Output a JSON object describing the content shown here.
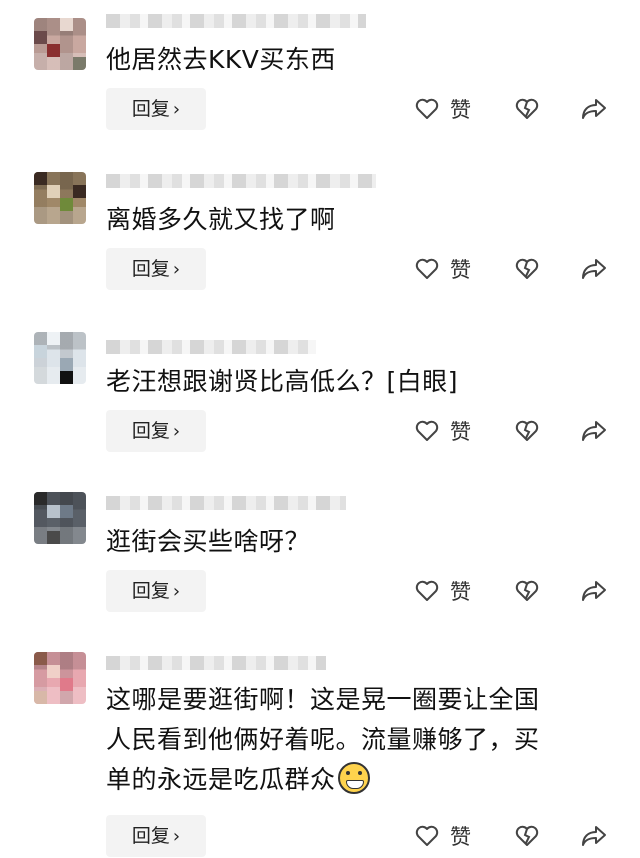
{
  "comments": [
    {
      "text_lines": [
        "他居然去KKV买东西"
      ],
      "reply_label": "回复",
      "like_label": "赞",
      "avatar_colors": [
        "#6b4a4a",
        "#c9b0a8",
        "#8a2f2f",
        "#e8d8d0"
      ]
    },
    {
      "text_lines": [
        "离婚多久就又找了啊"
      ],
      "reply_label": "回复",
      "like_label": "赞",
      "avatar_colors": [
        "#3a2a22",
        "#a07a5a",
        "#6f8a3a",
        "#e0d0b8"
      ]
    },
    {
      "text_lines": [
        "老汪想跟谢贤比高低么？[白眼]"
      ],
      "reply_label": "回复",
      "like_label": "赞",
      "avatar_colors": [
        "#c8d4dc",
        "#eef2f5",
        "#9aa8b4",
        "#111111"
      ]
    },
    {
      "text_lines": [
        "逛街会买些啥呀？"
      ],
      "reply_label": "回复",
      "like_label": "赞",
      "avatar_colors": [
        "#2a2a2a",
        "#6e7a88",
        "#b8c2cc",
        "#4a4a4a"
      ]
    },
    {
      "text_lines": [
        "这哪是要逛街啊！这是晃一圈要让全国",
        "人民看到他俩好着呢。流量赚够了，买",
        "单的永远是吃瓜群众"
      ],
      "reply_label": "回复",
      "like_label": "赞",
      "emoji_icon": "grinning-face-icon",
      "avatar_colors": [
        "#8a5a4a",
        "#e07a8a",
        "#d8b8a8",
        "#f0d0c8"
      ]
    }
  ]
}
